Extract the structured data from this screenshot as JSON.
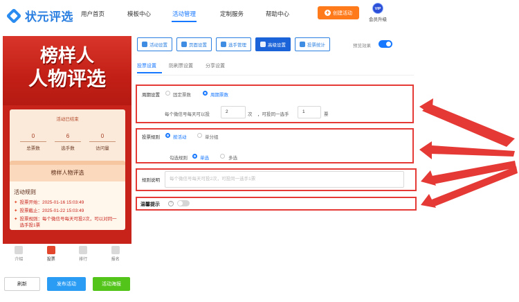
{
  "app": {
    "logo_text": "状元评选"
  },
  "nav": {
    "items": [
      "用户首页",
      "模板中心",
      "活动管理",
      "定制服务",
      "帮助中心"
    ],
    "create_label": "创建活动",
    "vip_badge": "VIP",
    "vip_label": "会员升级"
  },
  "preview": {
    "banner_line1": "榜样人",
    "banner_line2": "人物评选",
    "status": "活动已结束",
    "stats": [
      {
        "value": "0",
        "label": "总票数"
      },
      {
        "value": "6",
        "label": "选手数"
      },
      {
        "value": "0",
        "label": "访问量"
      }
    ],
    "info_title": "榜样人物评选",
    "rules_heading": "活动规则",
    "rules": [
      "投票开始：2025-01-16 15:03:49",
      "投票截止：2025-01-22 15:03:49",
      "投票规则：每个微信号每天可投2次，可以对同一选手投1票"
    ],
    "bottom_tabs": [
      "介绍",
      "投票",
      "排行",
      "报名"
    ]
  },
  "bottom_buttons": {
    "refresh": "刷新",
    "publish": "发布活动",
    "poster": "活动海报"
  },
  "settings_tabs": [
    "活动设置",
    "页面设置",
    "选手管理",
    "高级设置",
    "投票统计"
  ],
  "preview_toggle_label": "预览效果",
  "sub_tabs": [
    "投票设置",
    "防刷票设置",
    "分享设置"
  ],
  "cycle": {
    "label": "周期设置",
    "options": [
      "固定票数",
      "周期票数"
    ],
    "daily_label": "每个微信号每天可以投",
    "daily_value": "2",
    "daily_unit": "次",
    "same_label": "，可投同一选手",
    "same_value": "1",
    "same_unit": "票"
  },
  "vote_rule": {
    "label": "投票规则",
    "options": [
      "按活动",
      "单分组"
    ],
    "select_label": "勾选规则",
    "select_options": [
      "单选",
      "多选"
    ]
  },
  "rule_desc": {
    "label": "规则说明",
    "placeholder": "每个微信号每天可投2次，可投同一选手1票"
  },
  "reminder": {
    "label": "温馨提示",
    "help": "?"
  }
}
